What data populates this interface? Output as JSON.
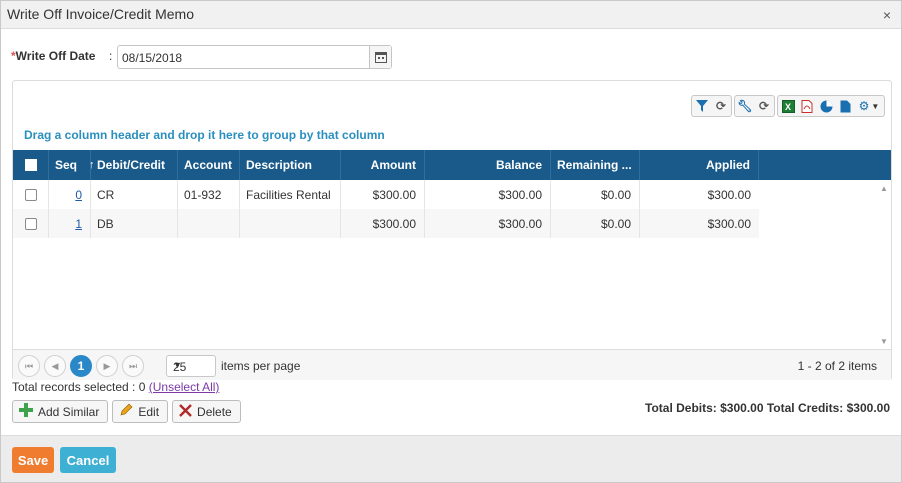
{
  "dialog": {
    "title": "Write Off Invoice/Credit Memo",
    "close_glyph": "×"
  },
  "date_field": {
    "required_mark": "*",
    "label": "Write Off Date",
    "colon": ":",
    "value": "08/15/2018"
  },
  "grid": {
    "group_hint": "Drag a column header and drop it here to group by that column",
    "columns": [
      "Seq",
      "Debit/Credit",
      "Account",
      "Description",
      "Amount",
      "Balance",
      "Remaining ...",
      "Applied"
    ],
    "sort_glyph": "↑",
    "rows": [
      {
        "seq": "0",
        "type": "CR",
        "account": "01-932",
        "description": "Facilities Rental",
        "amount": "$300.00",
        "balance": "$300.00",
        "remaining": "$0.00",
        "applied": "$300.00"
      },
      {
        "seq": "1",
        "type": "DB",
        "account": "",
        "description": "",
        "amount": "$300.00",
        "balance": "$300.00",
        "remaining": "$0.00",
        "applied": "$300.00"
      }
    ],
    "toolbar_icons": [
      "filter-icon",
      "refresh-icon",
      "wrench-icon",
      "refresh-icon",
      "excel-icon",
      "pdf-icon",
      "chart-icon",
      "document-icon",
      "gear-icon"
    ]
  },
  "pager": {
    "first": "⏮",
    "prev": "◀",
    "current_page": "1",
    "next": "▶",
    "last": "⏭",
    "page_size": "25",
    "per_page_label": "items per page",
    "count": "1 - 2 of 2 items"
  },
  "selection": {
    "text": "Total records selected : 0 ",
    "unselect": "(Unselect All)"
  },
  "actions": {
    "add_similar": "Add Similar",
    "edit": "Edit",
    "delete": "Delete"
  },
  "totals": "Total Debits: $300.00 Total Credits: $300.00",
  "footer": {
    "save": "Save",
    "cancel": "Cancel"
  },
  "colors": {
    "header": "#1a5a8a",
    "save": "#f07c2f",
    "cancel": "#3db0d3",
    "hint": "#2a8fbf",
    "active_page": "#2a88c8"
  }
}
